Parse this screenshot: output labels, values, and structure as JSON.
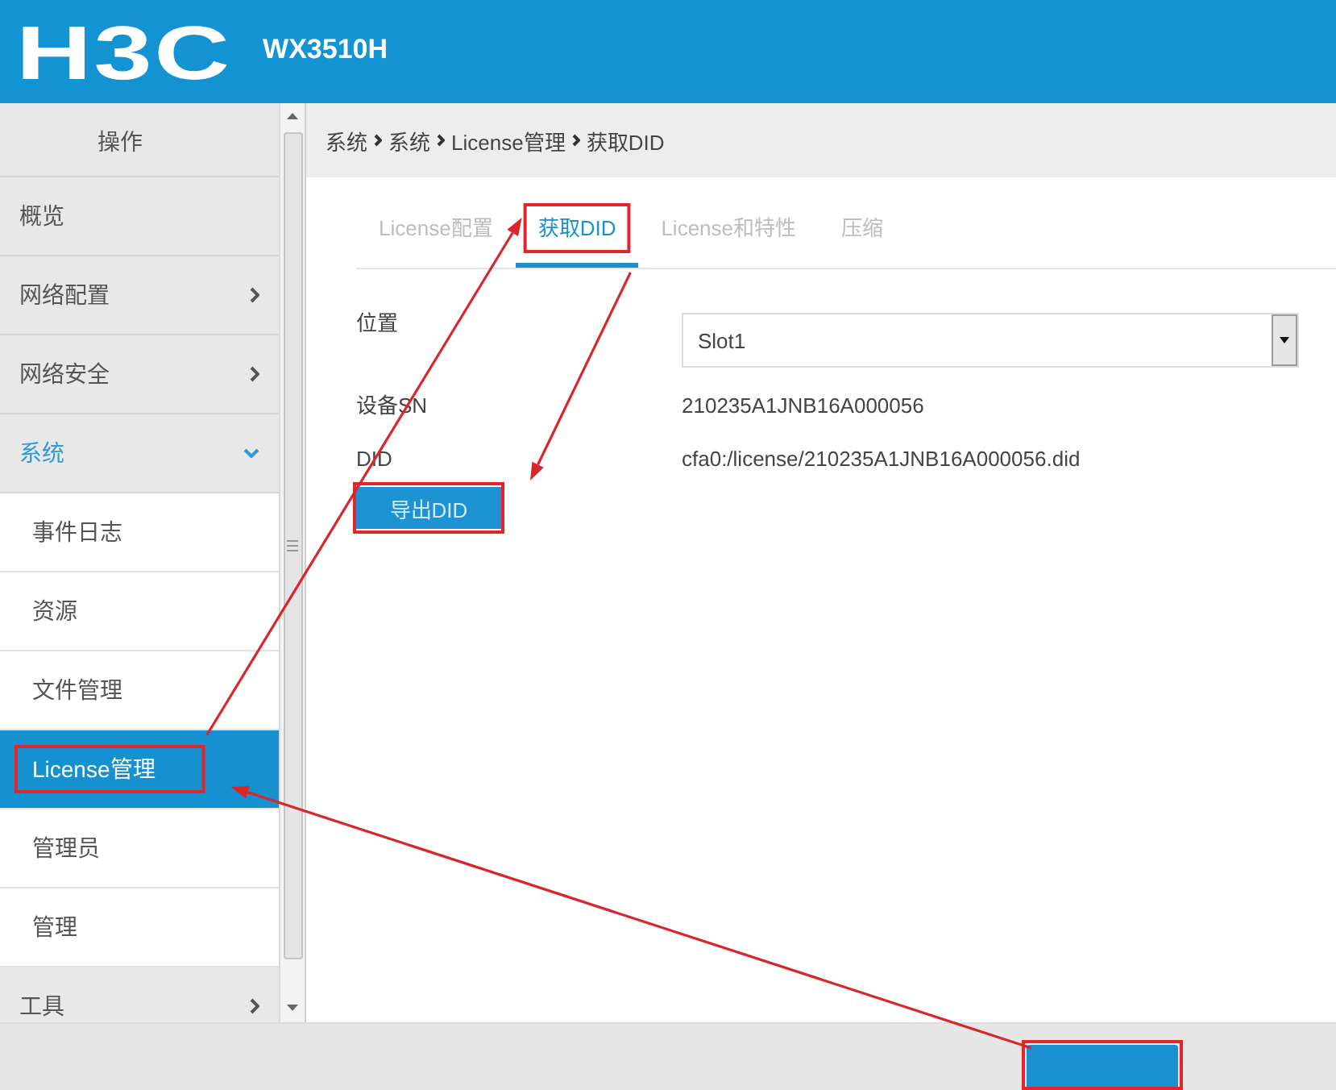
{
  "header": {
    "logo": "H3C",
    "model": "WX3510H"
  },
  "sidebar": {
    "title": "操作",
    "items": [
      {
        "label": "概览",
        "kind": "link",
        "selected": false
      },
      {
        "label": "网络配置",
        "kind": "group",
        "expanded": false,
        "selected": false
      },
      {
        "label": "网络安全",
        "kind": "group",
        "expanded": false,
        "selected": false
      },
      {
        "label": "系统",
        "kind": "group",
        "expanded": true,
        "selected": false,
        "children": [
          {
            "label": "事件日志",
            "selected": false,
            "highlighted": false
          },
          {
            "label": "资源",
            "selected": false,
            "highlighted": false
          },
          {
            "label": "文件管理",
            "selected": false,
            "highlighted": false
          },
          {
            "label": "License管理",
            "selected": true,
            "highlighted": true
          },
          {
            "label": "管理员",
            "selected": false,
            "highlighted": false
          },
          {
            "label": "管理",
            "selected": false,
            "highlighted": false
          }
        ]
      },
      {
        "label": "工具",
        "kind": "group",
        "expanded": false,
        "selected": false
      }
    ]
  },
  "breadcrumb": [
    "系统",
    "系统",
    "License管理",
    "获取DID"
  ],
  "tabs": [
    {
      "label": "License配置",
      "selected": false,
      "highlighted": false
    },
    {
      "label": "获取DID",
      "selected": true,
      "highlighted": true
    },
    {
      "label": "License和特性",
      "selected": false,
      "highlighted": false
    },
    {
      "label": "压缩",
      "selected": false,
      "highlighted": false
    }
  ],
  "form": {
    "fields": [
      {
        "kind": "select",
        "label": "位置",
        "value": "Slot1"
      },
      {
        "kind": "text",
        "label": "设备SN",
        "value": "210235A1JNB16A000056"
      },
      {
        "kind": "text",
        "label": "DID",
        "value": "cfa0:/license/210235A1JNB16A000056.did"
      }
    ],
    "export_button": {
      "label": "导出DID",
      "highlighted": true
    }
  },
  "footer": {
    "button": {
      "highlighted": true
    }
  },
  "annotations": {
    "arrows": [
      {
        "kind": "footer-to-menu"
      },
      {
        "kind": "menu-to-tab"
      },
      {
        "kind": "tab-to-button"
      }
    ]
  }
}
